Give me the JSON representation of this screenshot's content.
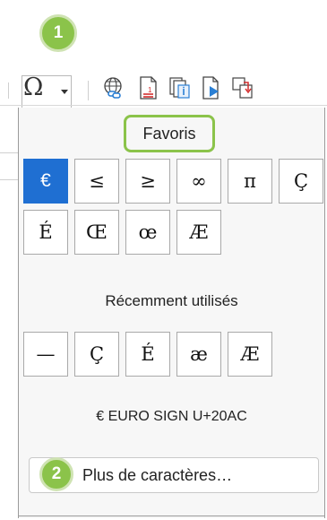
{
  "toolbar": {
    "special_char_symbol": "Ω",
    "badges": {
      "step1": "1",
      "step2": "2"
    },
    "icons": [
      "hyperlink-icon",
      "footnote-icon",
      "caption-icon",
      "bookmark-icon",
      "cross-reference-icon"
    ]
  },
  "panel": {
    "favorites_label": "Favoris",
    "favorites": [
      "€",
      "≤",
      "≥",
      "∞",
      "π",
      "Ç",
      "É",
      "Œ",
      "œ",
      "Æ"
    ],
    "selected_favorite": "€",
    "recent_label": "Récemment utilisés",
    "recent": [
      "—",
      "Ç",
      "É",
      "æ",
      "Æ"
    ],
    "char_info": "€ EURO SIGN U+20AC",
    "more_button": "Plus de caractères…"
  },
  "colors": {
    "badge": "#8bc34a",
    "selected_cell": "#1f6fd2"
  }
}
